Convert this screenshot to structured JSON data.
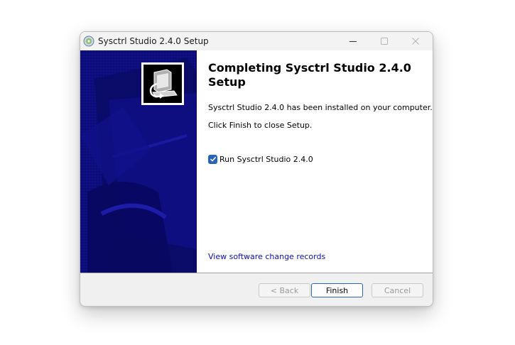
{
  "window": {
    "title": "Sysctrl Studio 2.4.0 Setup",
    "icon": "installer-disc-icon"
  },
  "titlebar_controls": {
    "minimize_icon": "minimize-icon",
    "maximize_icon": "maximize-icon",
    "close_icon": "close-icon"
  },
  "side_panel": {
    "logo_icon": "computer-install-icon",
    "background_color": "#0c0c7a"
  },
  "content": {
    "heading": "Completing Sysctrl Studio 2.4.0 Setup",
    "installed_text": "Sysctrl Studio 2.4.0 has been installed on your computer.",
    "finish_text": "Click Finish to close Setup.",
    "run_checkbox": {
      "label": "Run Sysctrl Studio 2.4.0",
      "checked": true
    },
    "link_text": "View software change records"
  },
  "footer": {
    "back_label": "< Back",
    "finish_label": "Finish",
    "cancel_label": "Cancel"
  },
  "colors": {
    "accent": "#2a64b8",
    "link": "#0b0bb0"
  }
}
